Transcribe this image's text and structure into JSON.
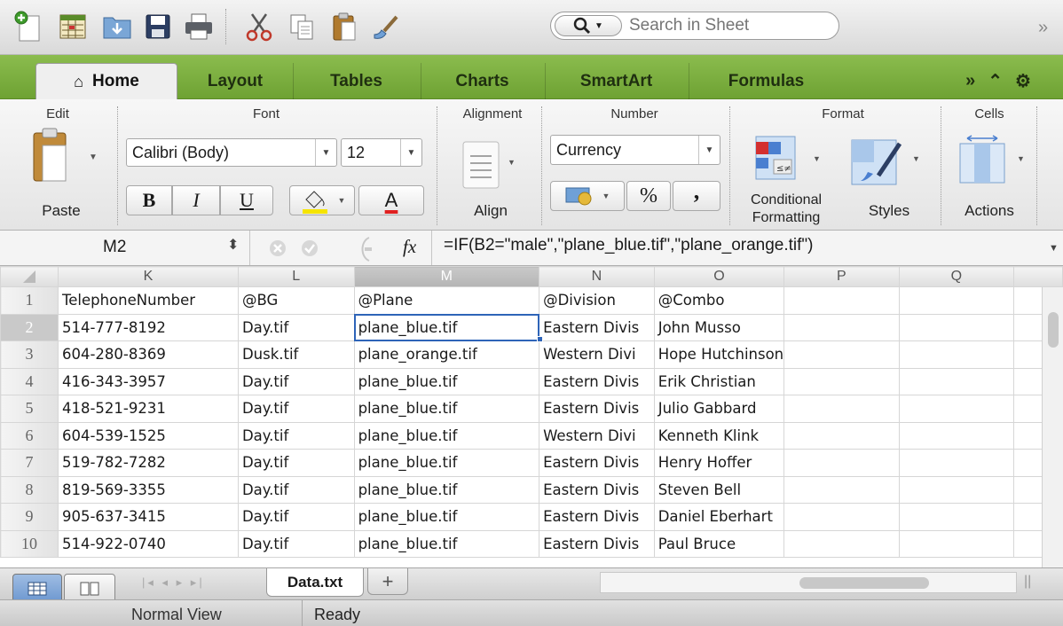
{
  "search": {
    "placeholder": "Search in Sheet"
  },
  "tabs": {
    "home": "Home",
    "layout": "Layout",
    "tables": "Tables",
    "charts": "Charts",
    "smartart": "SmartArt",
    "formulas": "Formulas"
  },
  "ribbon": {
    "groups": {
      "edit": "Edit",
      "font": "Font",
      "alignment": "Alignment",
      "number": "Number",
      "format": "Format",
      "cells": "Cells"
    },
    "paste": "Paste",
    "font_name": "Calibri (Body)",
    "font_size": "12",
    "bold": "B",
    "italic": "I",
    "underline": "U",
    "font_color_glyph": "A",
    "align": "Align",
    "number_format": "Currency",
    "percent": "%",
    "comma": ",",
    "conditional_line1": "Conditional",
    "conditional_line2": "Formatting",
    "styles": "Styles",
    "actions": "Actions"
  },
  "formula_bar": {
    "name_box": "M2",
    "fx": "fx",
    "formula": "=IF(B2=\"male\",\"plane_blue.tif\",\"plane_orange.tif\")"
  },
  "grid": {
    "columns": [
      "K",
      "L",
      "M",
      "N",
      "O",
      "P",
      "Q"
    ],
    "rows": [
      {
        "num": "1",
        "k": "TelephoneNumber",
        "l": "@BG",
        "m": "@Plane",
        "n": "@Division",
        "o": "@Combo"
      },
      {
        "num": "2",
        "k": "514-777-8192",
        "l": "Day.tif",
        "m": "plane_blue.tif",
        "n": "Eastern Divis",
        "o": "John Musso"
      },
      {
        "num": "3",
        "k": "604-280-8369",
        "l": "Dusk.tif",
        "m": "plane_orange.tif",
        "n": "Western Divi",
        "o": "Hope Hutchinson"
      },
      {
        "num": "4",
        "k": "416-343-3957",
        "l": "Day.tif",
        "m": "plane_blue.tif",
        "n": "Eastern Divis",
        "o": "Erik Christian"
      },
      {
        "num": "5",
        "k": "418-521-9231",
        "l": "Day.tif",
        "m": "plane_blue.tif",
        "n": "Eastern Divis",
        "o": "Julio Gabbard"
      },
      {
        "num": "6",
        "k": "604-539-1525",
        "l": "Day.tif",
        "m": "plane_blue.tif",
        "n": "Western Divi",
        "o": "Kenneth Klink"
      },
      {
        "num": "7",
        "k": "519-782-7282",
        "l": "Day.tif",
        "m": "plane_blue.tif",
        "n": "Eastern Divis",
        "o": "Henry Hoffer"
      },
      {
        "num": "8",
        "k": "819-569-3355",
        "l": "Day.tif",
        "m": "plane_blue.tif",
        "n": "Eastern Divis",
        "o": "Steven Bell"
      },
      {
        "num": "9",
        "k": "905-637-3415",
        "l": "Day.tif",
        "m": "plane_blue.tif",
        "n": "Eastern Divis",
        "o": "Daniel Eberhart"
      },
      {
        "num": "10",
        "k": "514-922-0740",
        "l": "Day.tif",
        "m": "plane_blue.tif",
        "n": "Eastern Divis",
        "o": "Paul Bruce"
      }
    ]
  },
  "sheet_tabs": {
    "active": "Data.txt",
    "add": "+"
  },
  "status": {
    "view": "Normal View",
    "state": "Ready"
  },
  "colors": {
    "ribbon_green": "#7bae3f",
    "selection_blue": "#2e64b8",
    "underline_red": "#e02020",
    "highlight_yellow": "#f5e400"
  }
}
